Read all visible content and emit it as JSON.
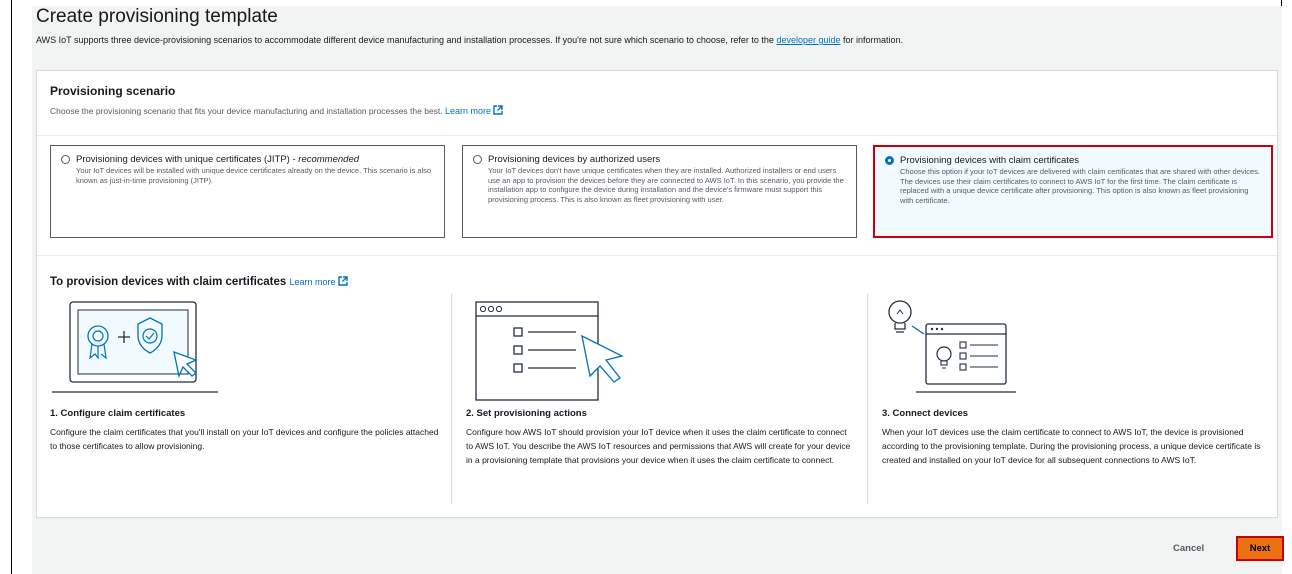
{
  "header": {
    "title": "Create provisioning template",
    "description_before": "AWS IoT supports three device-provisioning scenarios to accommodate different device manufacturing and installation processes. If you're not sure which scenario to choose, refer to the",
    "description_link": "developer guide",
    "description_after": "for information."
  },
  "scenario": {
    "title": "Provisioning scenario",
    "description": "Choose the provisioning scenario that fits your device manufacturing and installation processes the best.",
    "learn_more": "Learn more",
    "options": [
      {
        "title": "Provisioning devices with unique certificates (JITP) - ",
        "title_em": "recommended",
        "description": "Your IoT devices will be installed with unique device certificates already on the device. This scenario is also known as just-in-time provisioning (JITP).",
        "selected": false
      },
      {
        "title": "Provisioning devices by authorized users",
        "title_em": "",
        "description": "Your IoT devices don't have unique certificates when they are installed. Authorized installers or end users use an app to provision the devices before they are connected to AWS IoT. In this scenario, you provide the installation app to configure the device during installation and the device's firmware must support this provisioning process. This is also known as fleet provisioning with user.",
        "selected": false
      },
      {
        "title": "Provisioning devices with claim certificates",
        "title_em": "",
        "description": "Choose this option if your IoT devices are delivered with claim certificates that are shared with other devices. The devices use their claim certificates to connect to AWS IoT for the first time. The claim certificate is replaced with a unique device certificate after provisioning. This option is also known as fleet provisioning with certificate.",
        "selected": true
      }
    ]
  },
  "steps_section": {
    "title": "To provision devices with claim certificates",
    "learn_more": "Learn more",
    "steps": [
      {
        "title": "1. Configure claim certificates",
        "description": "Configure the claim certificates that you'll install on your IoT devices and configure the policies attached to those certificates to allow provisioning.",
        "icon": "certificate-laptop-icon"
      },
      {
        "title": "2. Set provisioning actions",
        "description": "Configure how AWS IoT should provision your IoT device when it uses the claim certificate to connect to AWS IoT. You describe the AWS IoT resources and permissions that AWS will create for your device in a provisioning template that provisions your device when it uses the claim certificate to connect.",
        "icon": "checklist-window-icon"
      },
      {
        "title": "3. Connect devices",
        "description": "When your IoT devices use the claim certificate to connect to AWS IoT, the device is provisioned according to the provisioning template. During the provisioning process, a unique device certificate is created and installed on your IoT device for all subsequent connections to AWS IoT.",
        "icon": "connected-device-icon"
      }
    ]
  },
  "footer": {
    "cancel_label": "Cancel",
    "next_label": "Next"
  },
  "colors": {
    "link": "#0073bb",
    "primary_button": "#ec7211",
    "highlight_border": "#c7000b",
    "selected_tile_bg": "#f1faff"
  }
}
